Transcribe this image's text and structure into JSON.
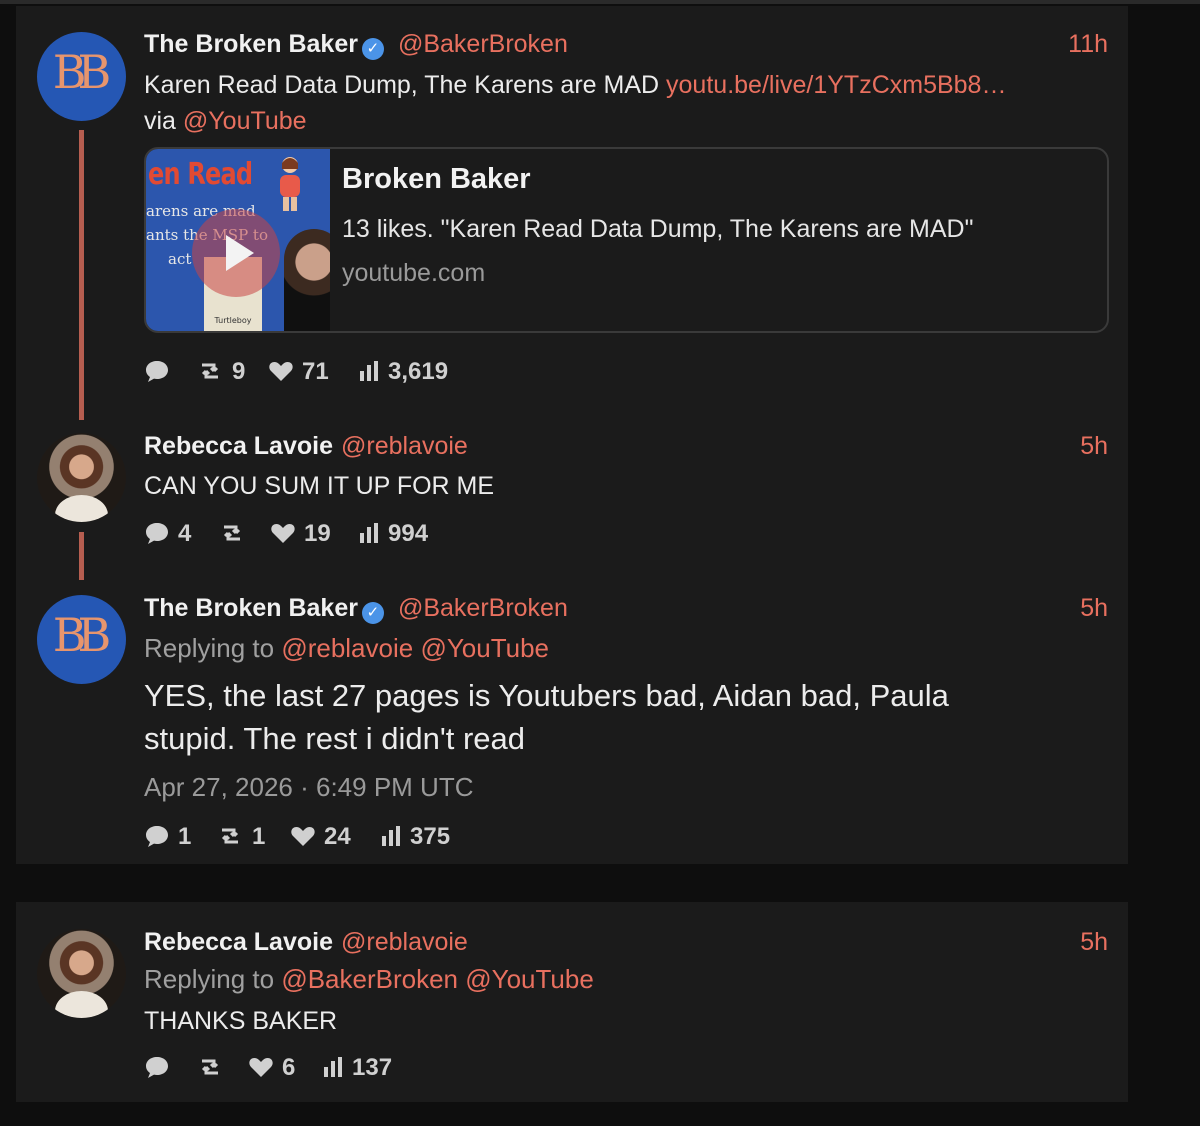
{
  "tweets": [
    {
      "name": "The Broken Baker",
      "handle": "@BakerBroken",
      "time": "11h",
      "avatar_initials": "BB",
      "text": "Karen Read Data Dump, The Karens are MAD",
      "link": "youtu.be/live/1YTzCxm5Bb8…",
      "via_prefix": "via",
      "via_mention": "@YouTube",
      "card": {
        "title": "Broken Baker",
        "description": "13 likes. \"Karen Read Data Dump, The Karens are MAD\"",
        "domain": "youtube.com",
        "thumb_title": "en Read",
        "thumb_lines": [
          "arens are mad",
          "ants the MSP to",
          "act"
        ],
        "thumb_poster": "Turtleboy"
      },
      "stats": {
        "replies": "",
        "retweets": "9",
        "likes": "71",
        "views": "3,619"
      }
    },
    {
      "name": "Rebecca Lavoie",
      "handle": "@reblavoie",
      "time": "5h",
      "text": "CAN YOU SUM IT UP FOR ME",
      "stats": {
        "replies": "4",
        "retweets": "",
        "likes": "19",
        "views": "994"
      }
    },
    {
      "name": "The Broken Baker",
      "handle": "@BakerBroken",
      "time": "5h",
      "avatar_initials": "BB",
      "replying_prefix": "Replying to",
      "replying_mentions": [
        "@reblavoie",
        "@YouTube"
      ],
      "text": "YES, the last 27 pages is Youtubers bad, Aidan bad, Paula stupid. The rest i didn't read",
      "datetime": "Apr 27, 2026 · 6:49 PM UTC",
      "stats": {
        "replies": "1",
        "retweets": "1",
        "likes": "24",
        "views": "375"
      }
    },
    {
      "name": "Rebecca Lavoie",
      "handle": "@reblavoie",
      "time": "5h",
      "replying_prefix": "Replying to",
      "replying_mentions": [
        "@BakerBroken",
        "@YouTube"
      ],
      "text": "THANKS BAKER",
      "stats": {
        "replies": "",
        "retweets": "",
        "likes": "6",
        "views": "137"
      }
    }
  ],
  "colors": {
    "background": "#0e0e0e",
    "panel": "#1b1b1b",
    "accent": "#e8705f",
    "thread_line": "#b65e50",
    "verified": "#4b94e8"
  },
  "icons": [
    "reply-icon",
    "retweet-icon",
    "heart-icon",
    "views-icon",
    "verified-icon",
    "play-icon"
  ]
}
